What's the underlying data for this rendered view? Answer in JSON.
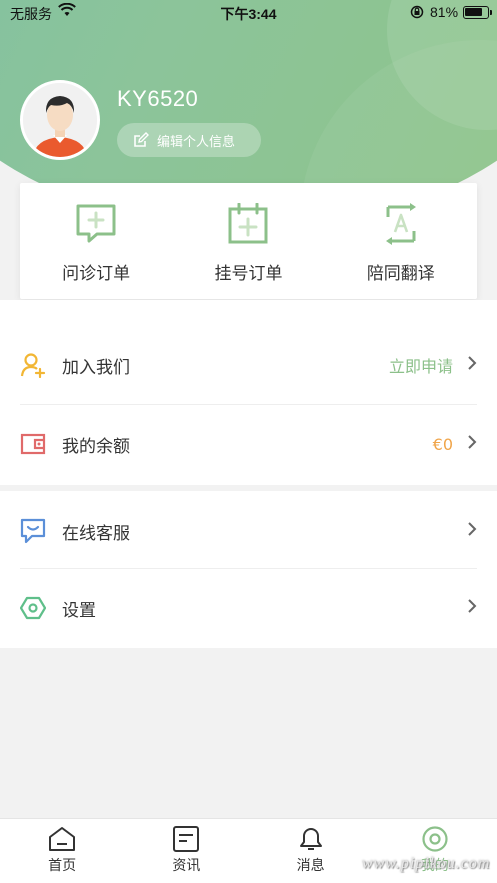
{
  "status_bar": {
    "carrier": "无服务",
    "time": "下午3:44",
    "battery_pct": "81%",
    "battery_level": 0.81
  },
  "profile": {
    "username": "KY6520",
    "edit_label": "编辑个人信息",
    "avatar_icon": "user-avatar"
  },
  "quick_actions": [
    {
      "label": "问诊订单",
      "icon": "chat-plus-icon"
    },
    {
      "label": "挂号订单",
      "icon": "calendar-plus-icon"
    },
    {
      "label": "陪同翻译",
      "icon": "translate-icon"
    }
  ],
  "menu_section1": [
    {
      "label": "加入我们",
      "value": "立即申请",
      "value_color": "#8cc08a",
      "icon": "user-add-icon",
      "icon_color": "#f2b634"
    },
    {
      "label": "我的余额",
      "value": "€0",
      "value_color": "#f0a54a",
      "icon": "wallet-icon",
      "icon_color": "#e06a6a"
    }
  ],
  "menu_section2": [
    {
      "label": "在线客服",
      "value": "",
      "icon": "customer-service-icon",
      "icon_color": "#5b8fd8"
    },
    {
      "label": "设置",
      "value": "",
      "icon": "settings-icon",
      "icon_color": "#5fbf8a"
    }
  ],
  "tabbar": [
    {
      "label": "首页",
      "icon": "home-icon"
    },
    {
      "label": "资讯",
      "icon": "news-icon"
    },
    {
      "label": "消息",
      "icon": "bell-icon"
    },
    {
      "label": "我的",
      "icon": "profile-icon",
      "active": true
    }
  ],
  "colors": {
    "accent": "#8cc08a",
    "header_gradient_start": "#7ec0a4",
    "header_gradient_end": "#8fc486"
  },
  "watermark": "www.pipikou.com"
}
